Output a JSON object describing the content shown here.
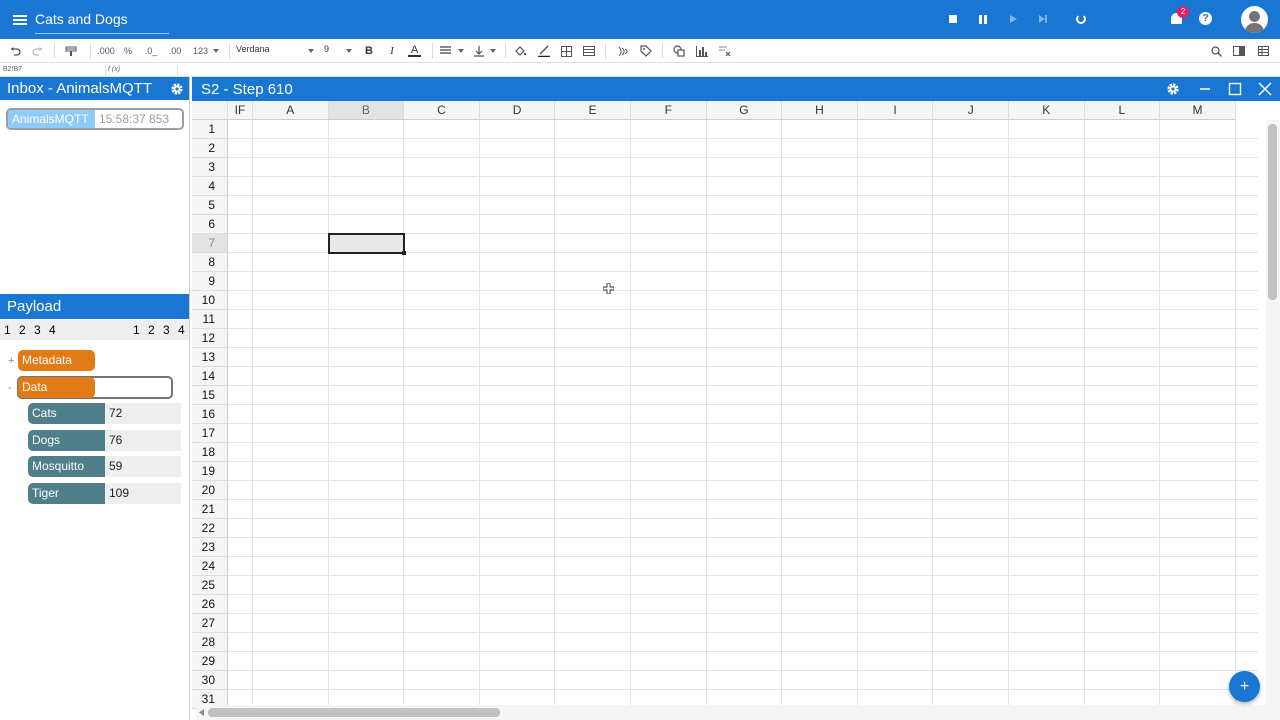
{
  "app": {
    "title": "Cats and Dogs",
    "notification_count": "2",
    "help_label": "?"
  },
  "toolbar": {
    "format_thousands": ".000",
    "format_percent": "%",
    "format_dec_down": ".0_",
    "format_dec_up": ".00",
    "number_format": "123",
    "font_family": "Verdana",
    "font_size": "9",
    "bold": "B",
    "italic": "I",
    "font_color": "A"
  },
  "formula_bar": {
    "cell_ref": "B2!B7",
    "fx_label": "f (x)"
  },
  "inbox": {
    "title": "Inbox - AnimalsMQTT",
    "items": [
      {
        "name": "AnimalsMQTT",
        "time": "15:58:37 853"
      }
    ]
  },
  "payload": {
    "title": "Payload",
    "pager_left": [
      "1",
      "2",
      "3",
      "4"
    ],
    "pager_right": [
      "1",
      "2",
      "3",
      "4"
    ],
    "nodes": [
      {
        "label": "Metadata",
        "expander": "+"
      },
      {
        "label": "Data",
        "expander": "-"
      }
    ],
    "data": [
      {
        "key": "Cats",
        "value": "72"
      },
      {
        "key": "Dogs",
        "value": "76"
      },
      {
        "key": "Mosquitto",
        "value": "59"
      },
      {
        "key": "Tiger",
        "value": "109"
      }
    ]
  },
  "sheet": {
    "title": "S2 - Step 610",
    "if_column": "IF",
    "columns": [
      "A",
      "B",
      "C",
      "D",
      "E",
      "F",
      "G",
      "H",
      "I",
      "J",
      "K",
      "L",
      "M"
    ],
    "rows": [
      "1",
      "2",
      "3",
      "4",
      "5",
      "6",
      "7",
      "8",
      "9",
      "10",
      "11",
      "12",
      "13",
      "14",
      "15",
      "16",
      "17",
      "18",
      "19",
      "20",
      "21",
      "22",
      "23",
      "24",
      "25",
      "26",
      "27",
      "28",
      "29",
      "30",
      "31"
    ],
    "selected_cell": "B7"
  },
  "fab": {
    "label": "+"
  },
  "colors": {
    "primary": "#1976d2",
    "orange_tag": "#e07b15",
    "teal_key": "#4f7f88",
    "badge": "#e91e63"
  }
}
